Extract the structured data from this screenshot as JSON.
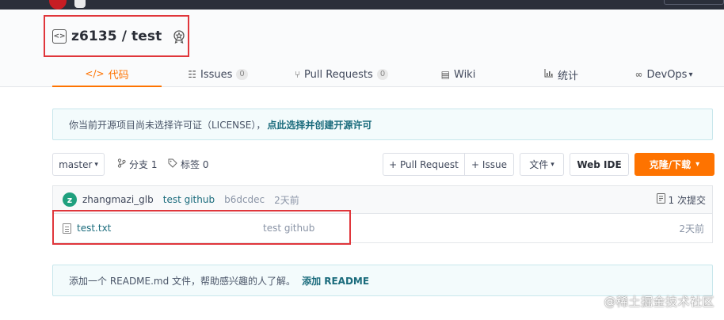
{
  "colors": {
    "accent": "#fe7300",
    "highlight_box": "#e0363b",
    "link": "#1a6b7c"
  },
  "repo": {
    "title": "z6135 / test",
    "title_icon": "code-icon",
    "badge_icon": "award-badge-icon"
  },
  "tabs": [
    {
      "label": "代码",
      "icon": "</>",
      "count": "",
      "active": true
    },
    {
      "label": "Issues",
      "icon": "☷",
      "count": "0",
      "active": false
    },
    {
      "label": "Pull Requests",
      "icon": "⑂",
      "count": "0",
      "active": false
    },
    {
      "label": "Wiki",
      "icon": "▤",
      "count": "",
      "active": false
    },
    {
      "label": "统计",
      "icon": "📊",
      "count": "",
      "active": false
    },
    {
      "label": "DevOps",
      "icon": "∞",
      "count": "",
      "active": false,
      "dropdown": "▾"
    }
  ],
  "notice": {
    "text": "你当前开源项目尚未选择许可证（LICENSE），",
    "link": "点此选择并创建开源许可"
  },
  "toolbar": {
    "branch": "master",
    "branch_caret": "▾",
    "branches_label": "分支 1",
    "tags_label": "标签 0",
    "pull_request": "+ Pull Request",
    "issue": "+ Issue",
    "files": "文件",
    "files_caret": "▾",
    "web_ide": "Web IDE",
    "clone": "克隆/下载",
    "clone_caret": "▾"
  },
  "commit": {
    "avatar_letter": "z",
    "author": "zhangmazi_glb",
    "message": "test github",
    "sha": "b6dcdec",
    "time": "2天前",
    "commit_count": "1 次提交"
  },
  "files": [
    {
      "name": "test.txt",
      "message": "test github",
      "time": "2天前"
    }
  ],
  "readme": {
    "text": "添加一个 README.md 文件，帮助感兴趣的人了解。",
    "link": "添加 README"
  },
  "watermark": "@稀土掘金技术社区"
}
